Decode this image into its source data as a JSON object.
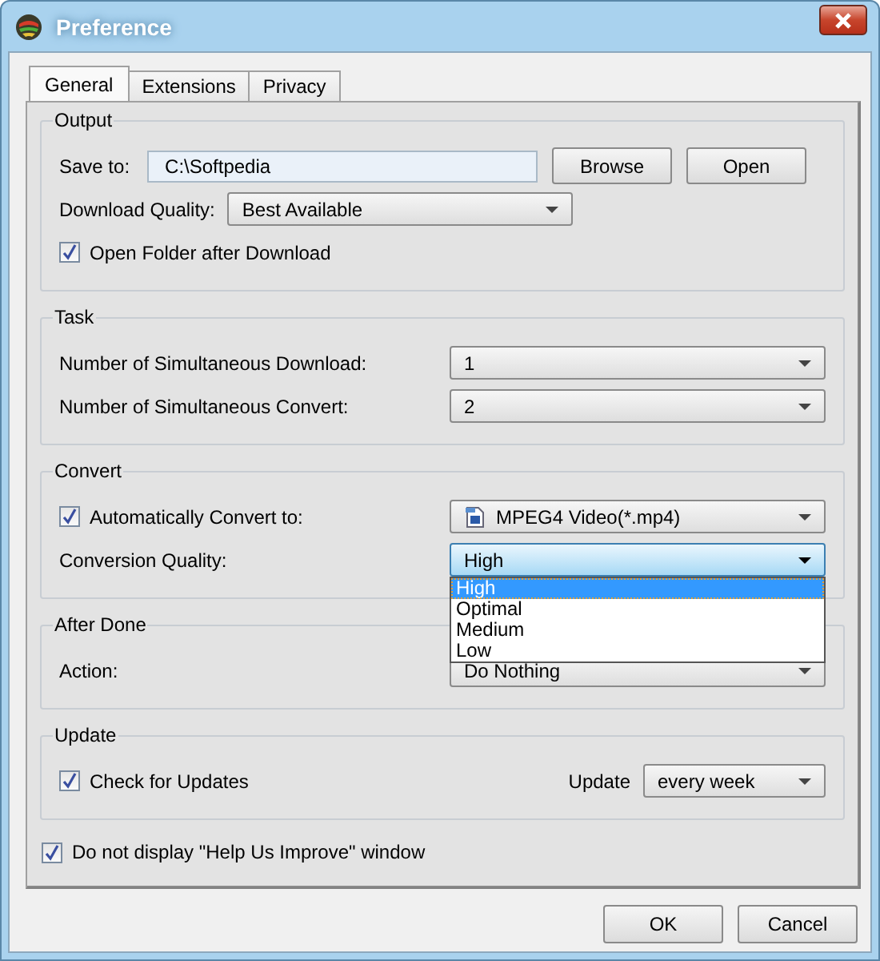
{
  "window": {
    "title": "Preference"
  },
  "tabs": [
    {
      "label": "General",
      "selected": true
    },
    {
      "label": "Extensions",
      "selected": false
    },
    {
      "label": "Privacy",
      "selected": false
    }
  ],
  "groups": [
    {
      "title": "Output",
      "rows": [
        {
          "kind": "path",
          "label": "Save to:",
          "value": "C:\\Softpedia",
          "buttons": [
            "Browse",
            "Open"
          ]
        },
        {
          "kind": "inline-select",
          "label": "Download Quality:",
          "value": "Best Available"
        },
        {
          "kind": "checkbox",
          "label": "Open Folder after Download",
          "checked": true
        }
      ]
    },
    {
      "title": "Task",
      "rows": [
        {
          "kind": "select",
          "label": "Number of Simultaneous Download:",
          "value": "1"
        },
        {
          "kind": "select",
          "label": "Number of Simultaneous Convert:",
          "value": "2"
        }
      ]
    },
    {
      "title": "Convert",
      "rows": [
        {
          "kind": "check-select",
          "label": "Automatically Convert to:",
          "checked": true,
          "value": "MPEG4 Video(*.mp4)"
        },
        {
          "kind": "select",
          "label": "Conversion Quality:",
          "value": "High",
          "open": true,
          "options": [
            {
              "label": "High",
              "selected": true
            },
            {
              "label": "Optimal",
              "selected": false
            },
            {
              "label": "Medium",
              "selected": false
            },
            {
              "label": "Low",
              "selected": false
            }
          ]
        }
      ]
    },
    {
      "title": "After Done",
      "rows": [
        {
          "kind": "select",
          "label": "Action:",
          "value": "Do Nothing"
        }
      ]
    },
    {
      "title": "Update",
      "rows": [
        {
          "kind": "check-right-select",
          "label": "Check for Updates",
          "checked": true,
          "select_label": "Update",
          "value": "every week"
        }
      ]
    }
  ],
  "footer_checkbox": {
    "label": "Do not display \"Help Us Improve\" window",
    "checked": true
  },
  "buttons": [
    "OK",
    "Cancel"
  ]
}
